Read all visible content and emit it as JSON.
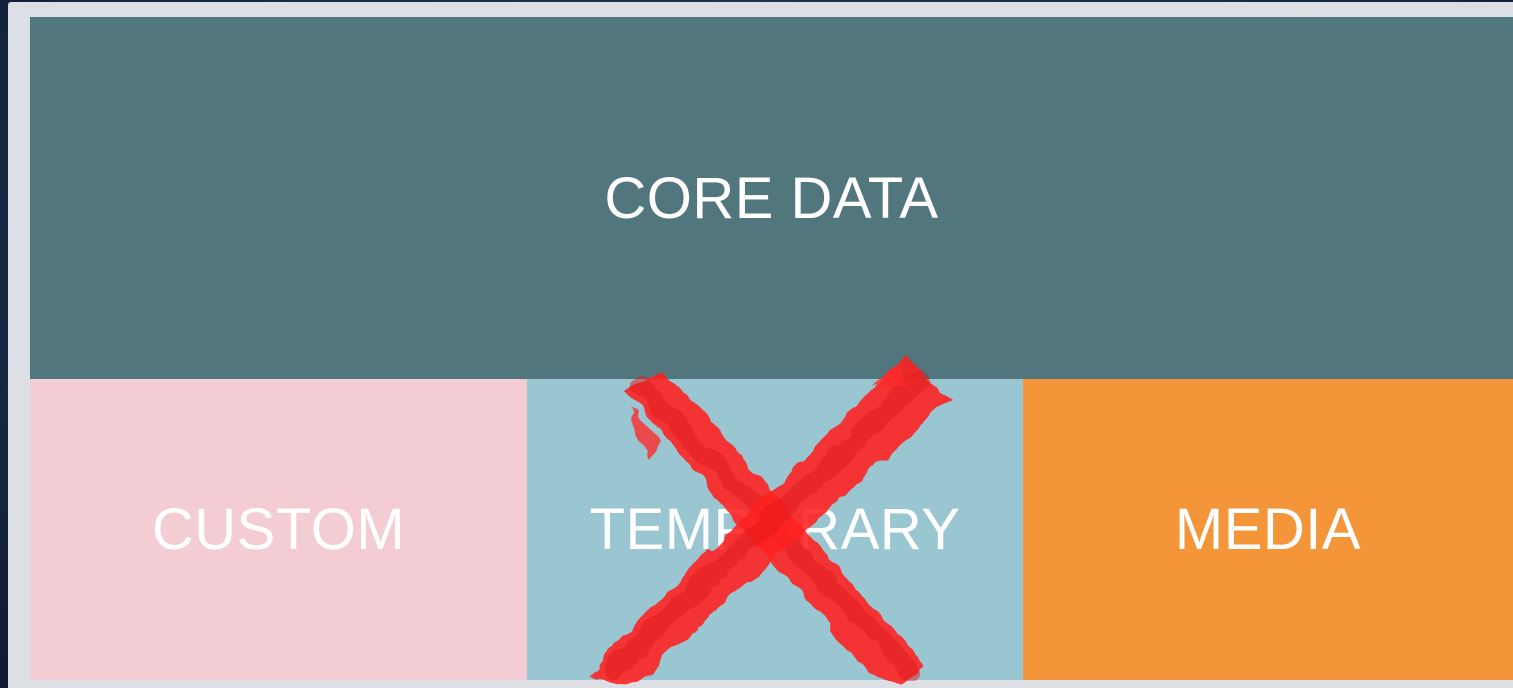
{
  "diagram": {
    "core": {
      "label": "CORE DATA",
      "color": "#52767e"
    },
    "custom": {
      "label": "CUSTOM",
      "color": "#f4ccd3"
    },
    "temporary": {
      "label": "TEMPORARY",
      "color": "#9ac6d1",
      "crossed_out": true
    },
    "media": {
      "label": "MEDIA",
      "color": "#f4953a"
    },
    "cross_mark": {
      "icon": "red-x-cross-icon",
      "color": "#ff1e1e"
    }
  }
}
